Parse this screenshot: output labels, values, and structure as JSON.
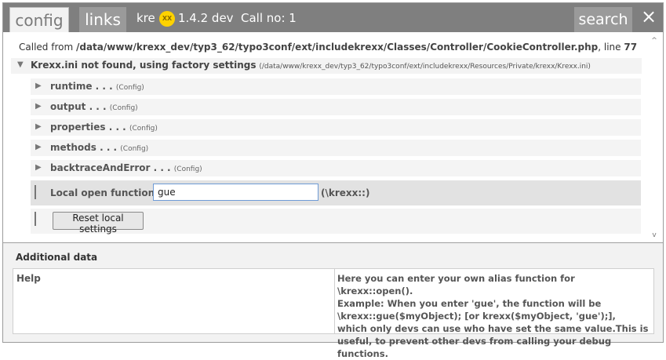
{
  "tabs": {
    "config": "config",
    "links": "links"
  },
  "header": {
    "kre": "kre",
    "badge": "XX",
    "version": "1.4.2 dev",
    "call": "Call no: 1",
    "search": "search",
    "close_icon": "close-icon"
  },
  "calledfrom": {
    "prefix": "Called from",
    "path": "/data/www/krexx_dev/typ3_62/typo3conf/ext/includekrexx/Classes/Controller/CookieController.php",
    "line_label": ", line",
    "line": "77"
  },
  "krexx_ini": {
    "label": "Krexx.ini not found, using factory settings",
    "path": "(/data/www/krexx_dev/typ3_62/typo3conf/ext/includekrexx/Resources/Private/krexx/Krexx.ini)"
  },
  "settings": [
    {
      "label": "runtime . . .",
      "tag": "(Config)"
    },
    {
      "label": "output . . .",
      "tag": "(Config)"
    },
    {
      "label": "properties . . .",
      "tag": "(Config)"
    },
    {
      "label": "methods . . .",
      "tag": "(Config)"
    },
    {
      "label": "backtraceAndError . . .",
      "tag": "(Config)"
    }
  ],
  "local_open": {
    "label": "Local open function",
    "value": "gue",
    "suffix": "(\\krexx::)"
  },
  "reset_button": "Reset local settings",
  "additional": {
    "title": "Additional data",
    "help_label": "Help",
    "help_text": "Here you can enter your own alias function for \\krexx::open().\nExample: When you enter 'gue', the function will be\n\\krexx::gue($myObject); [or krexx($myObject, 'gue');],\nwhich only devs can use who have set the same value.This is\nuseful, to prevent other devs from calling your debug functions."
  },
  "colors": {
    "topbar": "#7f7f7f",
    "badge": "#ffd200",
    "input_border": "#6e9bd6"
  }
}
